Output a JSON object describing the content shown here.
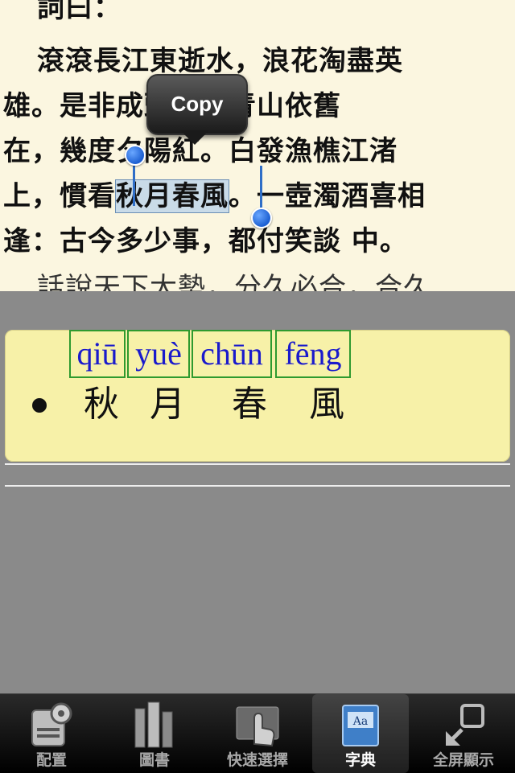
{
  "reader": {
    "line0": "詞曰：",
    "line1": "滾滾長江東逝水，浪花淘盡英",
    "line2_a": "雄。是非成",
    "line2_b": "頭空：青山依舊",
    "line3_a": "在，幾度夕陽紅。",
    "line3_b": "白發漁樵江渚",
    "line4_a": "上，慣看",
    "line4_sel": "秋月春風",
    "line4_b": "。一壺濁酒喜相",
    "line5": "逢：古今多少事，都付笑談 中。",
    "line6": "話說天下大勢，分久必合，合久"
  },
  "popup": {
    "copy_label": "Copy"
  },
  "dictionary": {
    "pinyin": [
      "qiū",
      "yuè",
      "chūn",
      "fēng"
    ],
    "hanzi": [
      "秋",
      "月",
      "春",
      "風"
    ]
  },
  "tabbar": {
    "tabs": [
      {
        "label": "配置",
        "icon": "settings-icon"
      },
      {
        "label": "圖書",
        "icon": "books-icon"
      },
      {
        "label": "快速選擇",
        "icon": "touch-icon"
      },
      {
        "label": "字典",
        "icon": "dictionary-icon",
        "active": true
      },
      {
        "label": "全屏顯示",
        "icon": "fullscreen-icon"
      }
    ]
  },
  "colors": {
    "reader_bg": "#fbf6e0",
    "card_bg": "#f7f1a8",
    "pinyin": "#1a1acc",
    "pinyin_box": "#2f9a2f",
    "selection": "#c9dbe8"
  }
}
